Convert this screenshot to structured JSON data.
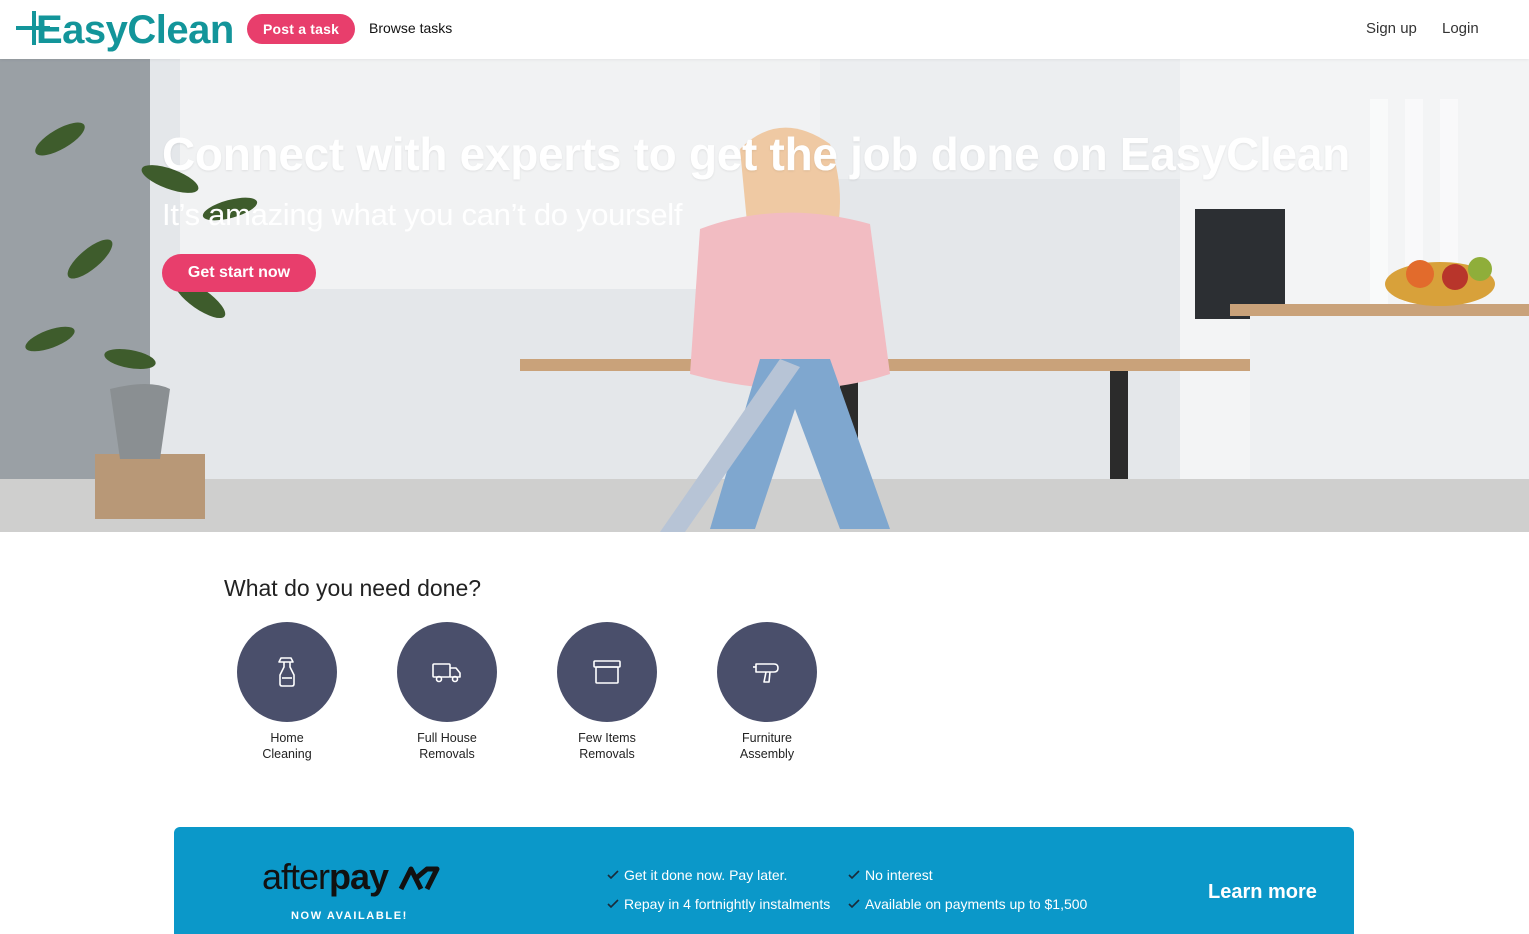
{
  "header": {
    "logo_text": "EasyClean",
    "post_task": "Post a task",
    "browse_tasks": "Browse tasks",
    "sign_up": "Sign up",
    "login": "Login"
  },
  "hero": {
    "title": "Connect with experts to get the job done on EasyClean",
    "subtitle": "It’s amazing what you can’t do yourself",
    "cta": "Get start now"
  },
  "services": {
    "title": "What do you need done?",
    "items": [
      {
        "line1": "Home",
        "line2": "Cleaning",
        "icon": "spray-bottle-icon"
      },
      {
        "line1": "Full House",
        "line2": "Removals",
        "icon": "truck-icon"
      },
      {
        "line1": "Few Items",
        "line2": "Removals",
        "icon": "box-icon"
      },
      {
        "line1": "Furniture",
        "line2": "Assembly",
        "icon": "drill-icon"
      }
    ]
  },
  "afterpay": {
    "logo_light": "after",
    "logo_bold": "pay",
    "available": "NOW AVAILABLE!",
    "features": [
      "Get it done now. Pay later.",
      "No interest",
      "Repay in 4 fortnightly instalments",
      "Available on payments up to $1,500"
    ],
    "learn_more": "Learn more"
  },
  "colors": {
    "brand_teal": "#13959a",
    "accent_pink": "#e83e6c",
    "service_circle": "#4a4f6b",
    "afterpay_blue": "#0b98c9"
  }
}
